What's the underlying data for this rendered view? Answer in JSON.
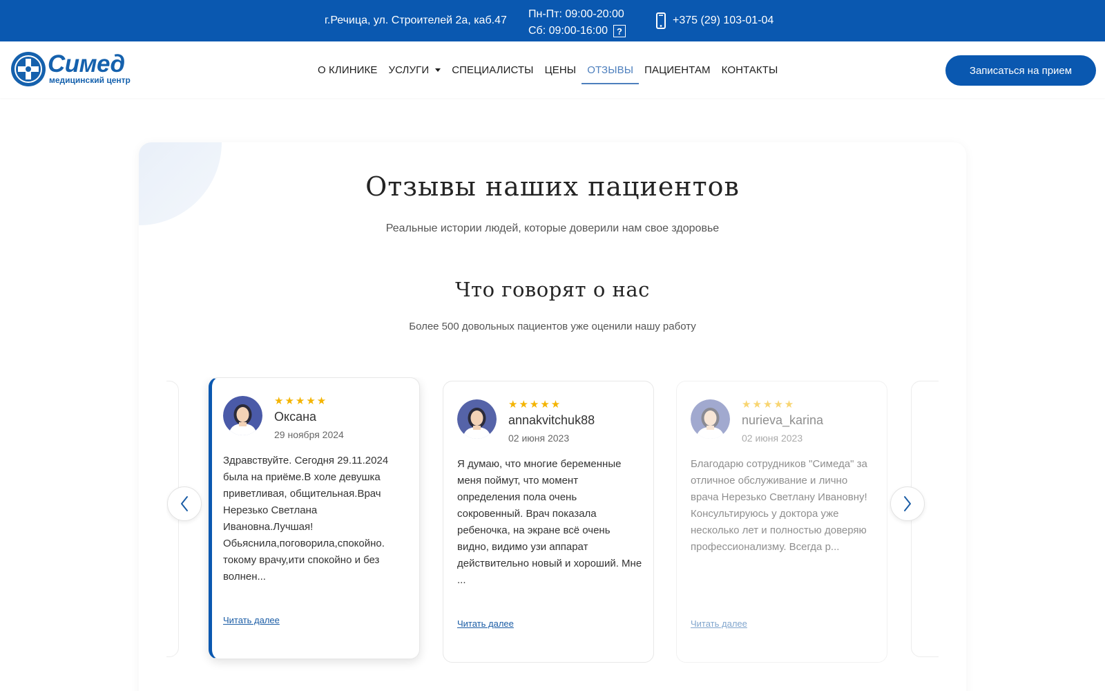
{
  "topbar": {
    "address": "г.Речица, ул. Строителей 2а, каб.47",
    "hours_weekdays": "Пн-Пт: 09:00-20:00",
    "hours_saturday": "Сб: 09:00-16:00",
    "help_icon_glyph": "?",
    "phone": "+375 (29) 103-01-04",
    "bg_color": "#0a58b0"
  },
  "logo": {
    "name": "Симед",
    "subtitle": "медицинский центр",
    "color": "#1561ad"
  },
  "nav": {
    "items": [
      {
        "label": "О КЛИНИКЕ",
        "active": false
      },
      {
        "label": "УСЛУГИ",
        "active": false,
        "dropdown": true
      },
      {
        "label": "СПЕЦИАЛИСТЫ",
        "active": false
      },
      {
        "label": "ЦЕНЫ",
        "active": false
      },
      {
        "label": "ОТЗЫВЫ",
        "active": true
      },
      {
        "label": "ПАЦИЕНТАМ",
        "active": false
      },
      {
        "label": "КОНТАКТЫ",
        "active": false
      }
    ],
    "cta_label": "Записаться на прием"
  },
  "reviews_section": {
    "title": "Отзывы наших пациентов",
    "subtitle": "Реальные истории людей, которые доверили нам свое здоровье",
    "heading": "Что говорят о нас",
    "heading_sub": "Более 500 довольных пациентов уже оценили нашу работу"
  },
  "reviews": [
    {
      "name": "Оксана",
      "date": "29 ноября 2024",
      "stars": "★★★★★",
      "rating": 5,
      "text": "Здравствуйте. Сегодня 29.11.2024 была на приёме.В холе девушка приветливая, общительная.Врач Нерезько Светлана Ивановна.Лучшая! Обьяснила,поговорила,спокойно. токому врачу,ити спокойно и без волнен...",
      "more": "Читать далее"
    },
    {
      "name": "annakvitchuk88",
      "date": "02 июня 2023",
      "stars": "★★★★★",
      "rating": 5,
      "text": "Я думаю, что многие беременные меня поймут, что момент определения пола очень сокровенный. Врач показала ребеночка, на экране всё очень видно, видимо узи аппарат действительно новый и хороший. Мне ...",
      "more": "Читать далее"
    },
    {
      "name": "nurieva_karina",
      "date": "02 июня 2023",
      "stars": "★★★★★",
      "rating": 5,
      "text": "Благодарю сотрудников \"Симеда\" за отличное обслуживание и лично врача Нерезько Светлану Ивановну! Консультируюсь у доктора уже несколько лет и полностью доверяю профессионализму. Всегда р...",
      "more": "Читать далее"
    }
  ],
  "icons": {
    "prev": "chevron-left-icon",
    "next": "chevron-right-icon",
    "phone": "phone-icon",
    "help": "question-icon"
  }
}
